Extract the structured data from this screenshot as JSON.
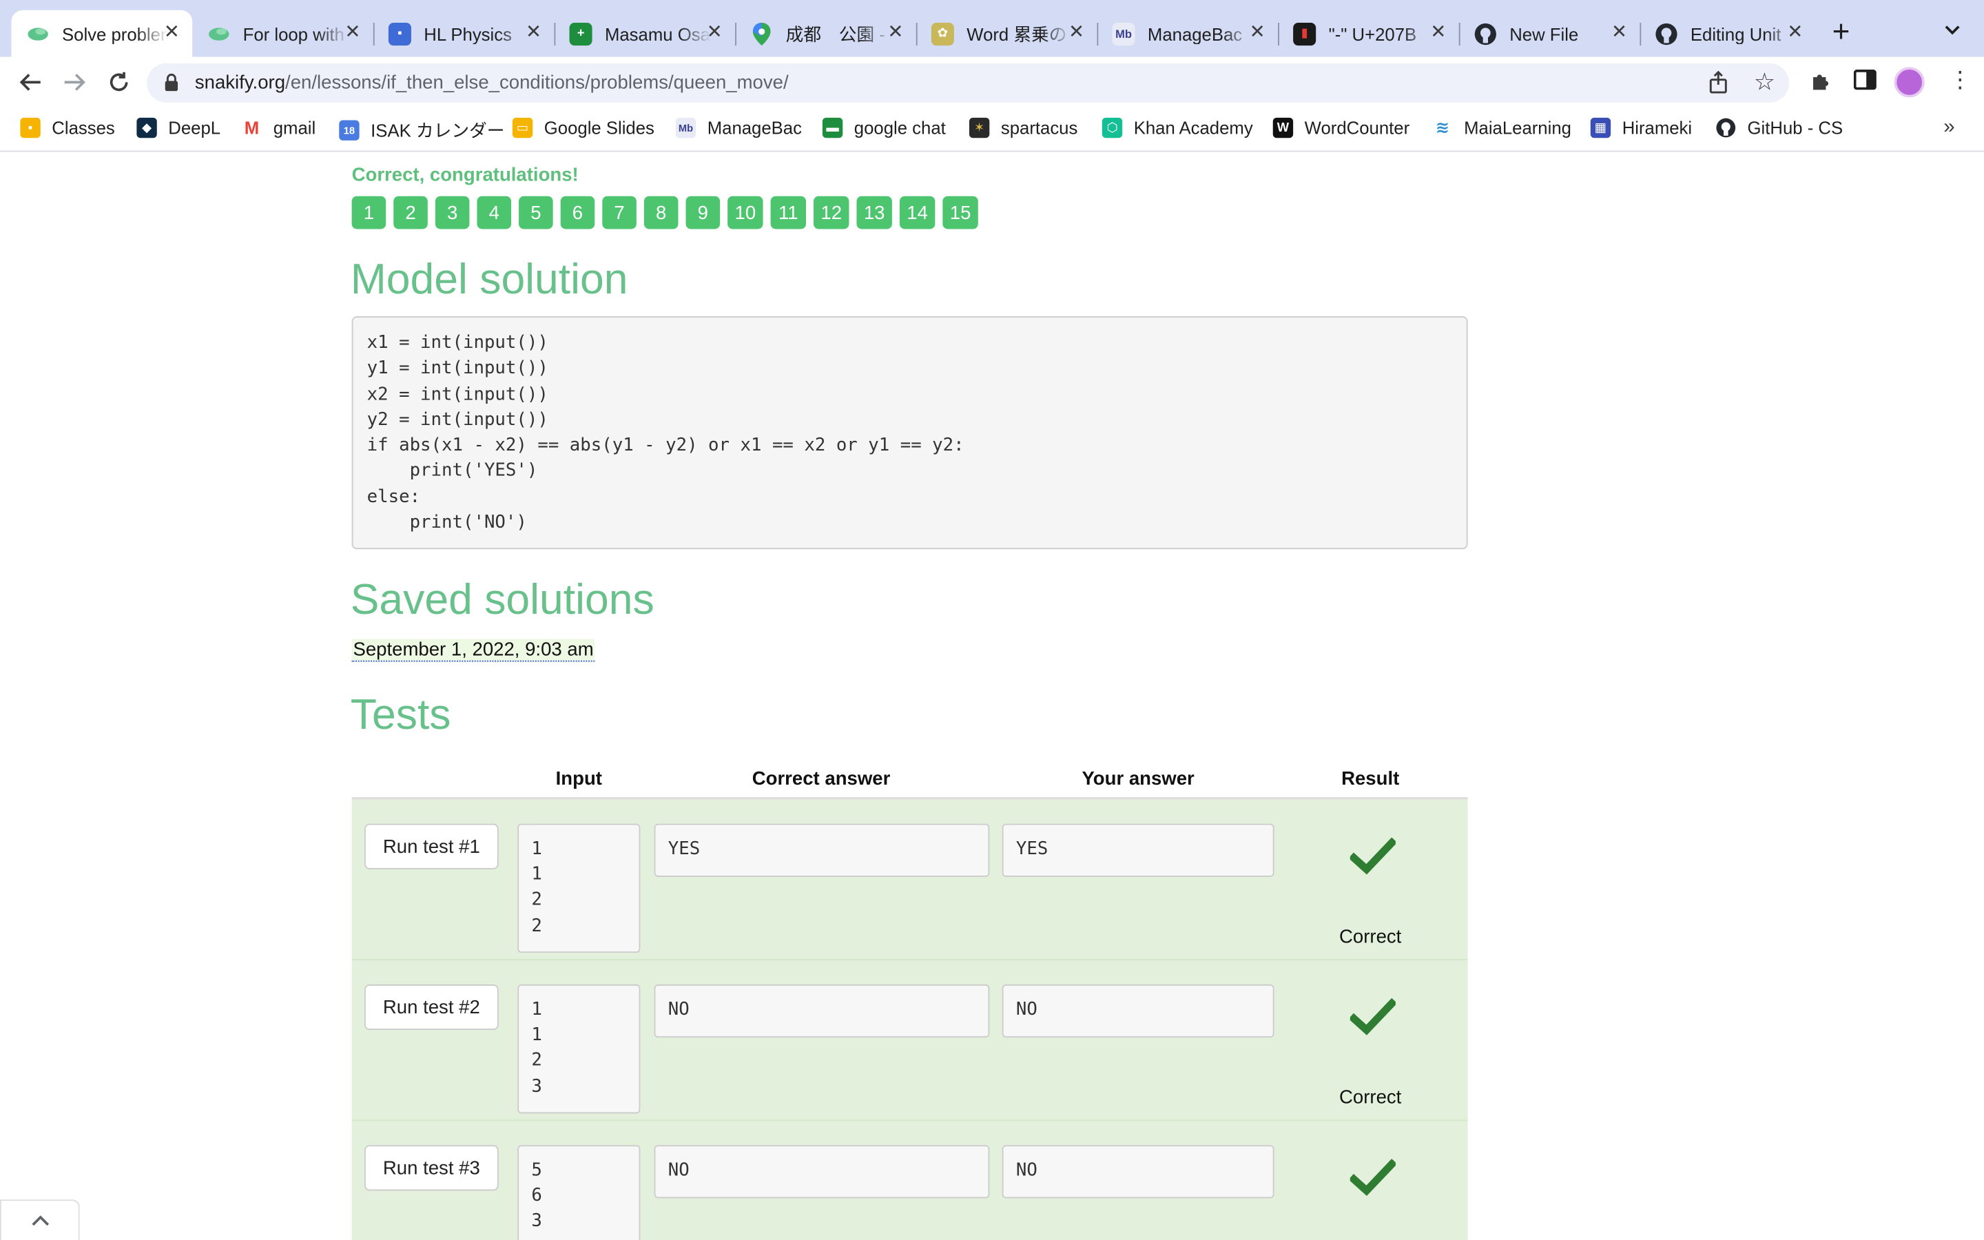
{
  "browser": {
    "tabs": [
      {
        "title": "Solve problem",
        "active": true
      },
      {
        "title": "For loop with"
      },
      {
        "title": "HL Physics"
      },
      {
        "title": "Masamu Osaki"
      },
      {
        "title": "成都　公園 -"
      },
      {
        "title": "Word 累乗の"
      },
      {
        "title": "ManageBac"
      },
      {
        "title": "\"-\" U+207B"
      },
      {
        "title": "New File"
      },
      {
        "title": "Editing Unit"
      }
    ],
    "url_host": "snakify.org",
    "url_path": "/en/lessons/if_then_else_conditions/problems/queen_move/",
    "bookmarks": [
      {
        "label": "Classes"
      },
      {
        "label": "DeepL"
      },
      {
        "label": "gmail"
      },
      {
        "label": "ISAK カレンダー"
      },
      {
        "label": "Google Slides"
      },
      {
        "label": "ManageBac"
      },
      {
        "label": "google chat"
      },
      {
        "label": "spartacus"
      },
      {
        "label": "Khan Academy"
      },
      {
        "label": "WordCounter"
      },
      {
        "label": "MaiaLearning"
      },
      {
        "label": "Hirameki"
      },
      {
        "label": "GitHub - CS"
      }
    ],
    "more_glyph": "»",
    "newtab_glyph": "+"
  },
  "page": {
    "success_message": "Correct, congratulations!",
    "problem_numbers": [
      "1",
      "2",
      "3",
      "4",
      "5",
      "6",
      "7",
      "8",
      "9",
      "10",
      "11",
      "12",
      "13",
      "14",
      "15"
    ],
    "model_solution_heading": "Model solution",
    "model_solution_code": [
      "x1 = int(input())",
      "y1 = int(input())",
      "x2 = int(input())",
      "y2 = int(input())",
      "if abs(x1 - x2) == abs(y1 - y2) or x1 == x2 or y1 == y2:",
      "    print('YES')",
      "else:",
      "    print('NO')"
    ],
    "saved_solutions_heading": "Saved solutions",
    "saved_solution_date": "September 1, 2022, 9:03 am",
    "tests_heading": "Tests",
    "tests_columns": {
      "input": "Input",
      "correct_answer": "Correct answer",
      "your_answer": "Your answer",
      "result": "Result"
    },
    "tests": [
      {
        "button": "Run test #1",
        "input": [
          "1",
          "1",
          "2",
          "2"
        ],
        "correct": "YES",
        "yours": "YES",
        "result": "Correct"
      },
      {
        "button": "Run test #2",
        "input": [
          "1",
          "1",
          "2",
          "3"
        ],
        "correct": "NO",
        "yours": "NO",
        "result": "Correct"
      },
      {
        "button": "Run test #3",
        "input": [
          "5",
          "6",
          "3"
        ],
        "correct": "NO",
        "yours": "NO",
        "result": ""
      }
    ]
  },
  "colors": {
    "accent_green": "#68c08b",
    "pager_green": "#4cc56e",
    "check_green": "#2e7d32",
    "row_bg": "#e3f1dc"
  }
}
